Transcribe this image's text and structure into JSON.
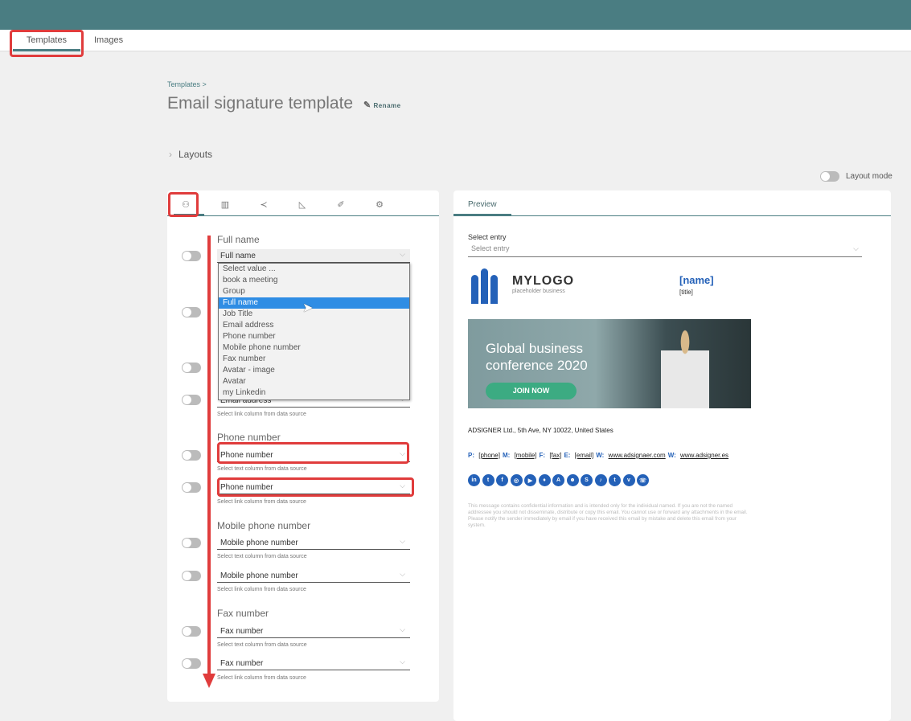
{
  "nav": {
    "tabs": [
      {
        "label": "Templates"
      },
      {
        "label": "Images"
      }
    ]
  },
  "breadcrumb": "Templates >",
  "title": "Email signature template",
  "rename": "Rename",
  "layouts": "Layouts",
  "layout_mode": "Layout mode",
  "left_tabs": [
    "person-icon",
    "building-icon",
    "share-icon",
    "chart-icon",
    "brush-icon",
    "gear-icon"
  ],
  "fields": {
    "full_name": {
      "label": "Full name",
      "value": "Full name"
    },
    "email": {
      "value": "Email address",
      "hint": "Select link column from data source"
    },
    "phone": {
      "label": "Phone number",
      "text_value": "Phone number",
      "text_hint": "Select text column from data source",
      "link_value": "Phone number",
      "link_hint": "Select link column from data source"
    },
    "mobile": {
      "label": "Mobile phone number",
      "text_value": "Mobile phone number",
      "text_hint": "Select text column from data source",
      "link_value": "Mobile phone number",
      "link_hint": "Select link column from data source"
    },
    "fax": {
      "label": "Fax number",
      "text_value": "Fax number",
      "text_hint": "Select text column from data source",
      "link_value": "Fax number",
      "link_hint": "Select link column from data source"
    }
  },
  "dropdown": {
    "options": [
      "Select value ...",
      "book a meeting",
      "Group",
      "Full name",
      "Job Title",
      "Email address",
      "Phone number",
      "Mobile phone number",
      "Fax number",
      "Avatar - image",
      "Avatar",
      "my Linkedin"
    ],
    "selected": "Full name"
  },
  "preview": {
    "tab": "Preview",
    "select_label": "Select entry",
    "select_placeholder": "Select entry",
    "logo_text": "MYLOGO",
    "logo_sub": "placeholder business",
    "name": "[name]",
    "job_title": "[title]",
    "banner_line1": "Global business",
    "banner_line2": "conference 2020",
    "banner_button": "JOIN NOW",
    "address": "ADSIGNER Ltd., 5th Ave, NY 10022, United States",
    "contacts": [
      {
        "k": "P:",
        "v": "[phone]"
      },
      {
        "k": "M:",
        "v": "[mobile]"
      },
      {
        "k": "F:",
        "v": "[fax]"
      },
      {
        "k": "E:",
        "v": "[email]"
      },
      {
        "k": "W:",
        "v": "www.adsignaer.com"
      },
      {
        "k": "W:",
        "v": "www.adsigner.es"
      }
    ],
    "social": [
      {
        "icon": "linkedin-icon",
        "g": "in"
      },
      {
        "icon": "twitter-icon",
        "g": "t"
      },
      {
        "icon": "facebook-icon",
        "g": "f"
      },
      {
        "icon": "instagram-icon",
        "g": "◎"
      },
      {
        "icon": "youtube-icon",
        "g": "▶"
      },
      {
        "icon": "location-icon",
        "g": "♦"
      },
      {
        "icon": "appstore-icon",
        "g": "A"
      },
      {
        "icon": "reddit-icon",
        "g": "☻"
      },
      {
        "icon": "skype-icon",
        "g": "S"
      },
      {
        "icon": "tiktok-icon",
        "g": "♪"
      },
      {
        "icon": "twitter-icon",
        "g": "t"
      },
      {
        "icon": "vimeo-icon",
        "g": "v"
      },
      {
        "icon": "whatsapp-icon",
        "g": "☏"
      }
    ],
    "disclaimer": "This message contains confidential information and is intended only for the individual named. If you are not the named addressee you should not disseminate, distribute or copy this email. You cannot use or forward any attachments in the email. Please notify the sender immediately by email if you have received this email by mistake and delete this email from your system."
  },
  "colors": {
    "header": "#4a7d82",
    "brand_blue": "#2461b8",
    "annotation": "#e03c3c",
    "selected_option": "#2f8de4"
  }
}
